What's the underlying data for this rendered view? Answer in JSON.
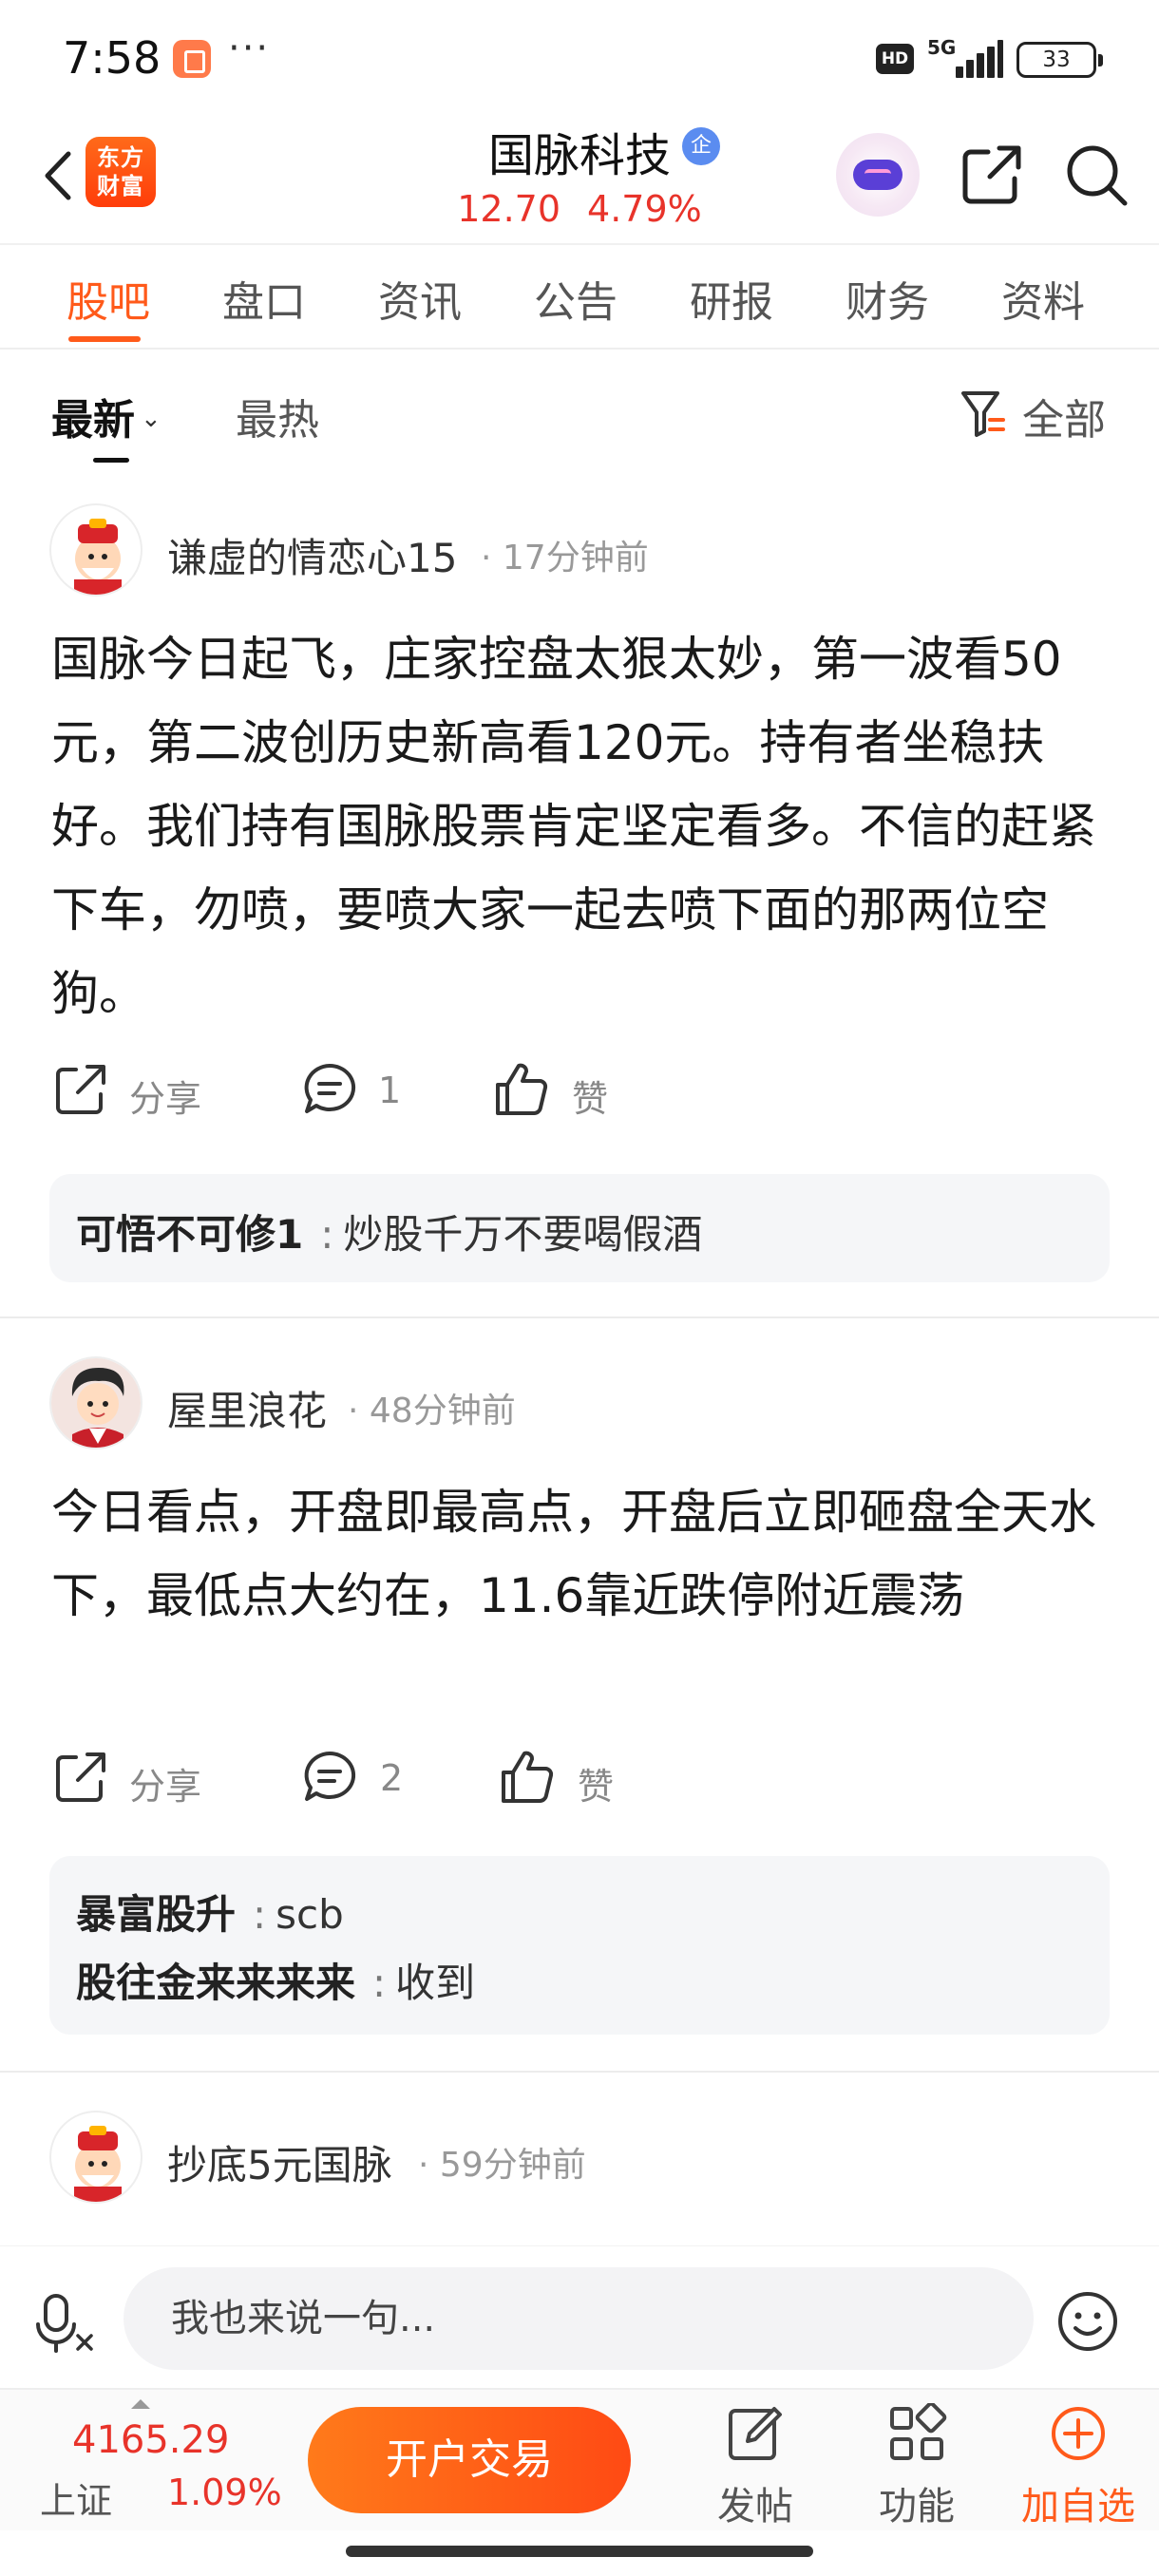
{
  "status_bar": {
    "time": "7:58",
    "more": "···",
    "network": "5G",
    "hd": "HD",
    "battery": "33"
  },
  "header": {
    "logo_line1": "东方",
    "logo_line2": "财富",
    "stock_name": "国脉科技",
    "badge": "企",
    "price": "12.70",
    "change_pct": "4.79%"
  },
  "tabs": [
    {
      "label": "股吧",
      "active": true
    },
    {
      "label": "盘口"
    },
    {
      "label": "资讯"
    },
    {
      "label": "公告"
    },
    {
      "label": "研报"
    },
    {
      "label": "财务"
    },
    {
      "label": "资料"
    }
  ],
  "sort": {
    "latest": "最新",
    "hot": "最热",
    "filter": "全部"
  },
  "posts": [
    {
      "author": "谦虚的情恋心15",
      "time": "17分钟前",
      "text": "国脉今日起飞，庄家控盘太狠太妙，第一波看50元，第二波创历史新高看120元。持有者坐稳扶好。我们持有国脉股票肯定坚定看多。不信的赶紧下车，勿喷，要喷大家一起去喷下面的那两位空狗。",
      "share": "分享",
      "comments": "1",
      "like": "赞",
      "replies": [
        {
          "user": "可悟不可修1",
          "text": "炒股千万不要喝假酒"
        }
      ]
    },
    {
      "author": "屋里浪花",
      "time": "48分钟前",
      "text": "今日看点，开盘即最高点，开盘后立即砸盘全天水下，最低点大约在，11.6靠近跌停附近震荡",
      "share": "分享",
      "comments": "2",
      "like": "赞",
      "replies": [
        {
          "user": "暴富股升",
          "text": "scb"
        },
        {
          "user": "股往金来来来来",
          "text": "收到"
        }
      ]
    },
    {
      "author": "抄底5元国脉",
      "time": "59分钟前"
    }
  ],
  "reply_bar": {
    "placeholder": "我也来说一句..."
  },
  "bottom_bar": {
    "index_value": "4165.29",
    "index_name": "上证",
    "index_change": "1.09%",
    "trade_button": "开户交易",
    "post": "发帖",
    "functions": "功能",
    "add_watchlist": "加自选"
  },
  "colors": {
    "accent": "#ff5a1a",
    "up_red": "#e8332a"
  }
}
